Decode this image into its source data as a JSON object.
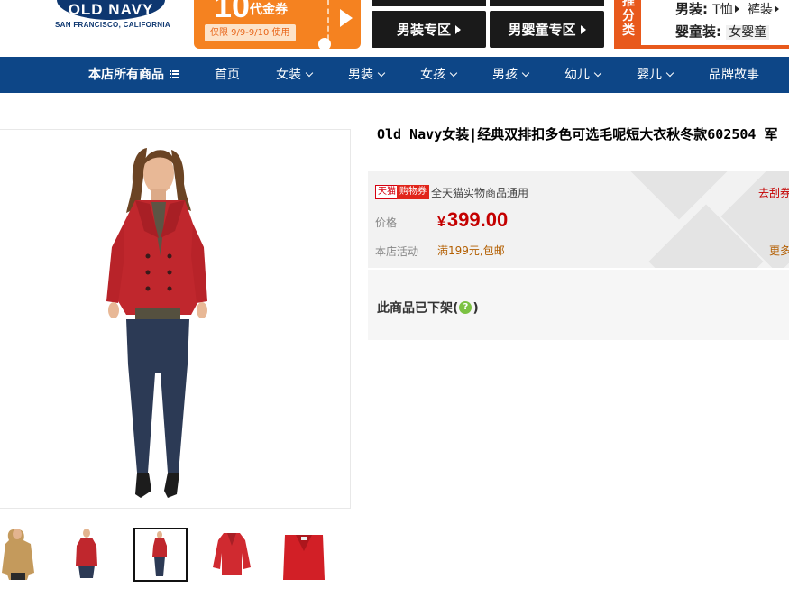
{
  "brand": {
    "logo_text": "OLD NAVY",
    "logo_sub": "SAN FRANCISCO, CALIFORNIA",
    "color": "#0e3770"
  },
  "banner": {
    "coupon_amount": "10",
    "coupon_label": "代金券",
    "coupon_dates": "仅限 9/9-9/10 使用",
    "mens_zone": "男装专区",
    "baby_boys_zone": "男婴童专区",
    "points_label": "推分类",
    "row1_title": "男装:",
    "row1_link1": "T恤",
    "row1_link2": "裤装",
    "row2_title": "婴童装:",
    "row2_link1": "女婴童"
  },
  "nav": {
    "all_products": "本店所有商品",
    "items": [
      "首页",
      "女装",
      "男装",
      "女孩",
      "男孩",
      "幼儿",
      "婴儿",
      "品牌故事"
    ],
    "color": "#0d4687"
  },
  "gallery": {
    "thumbnails": [
      "camel-coat",
      "red-coat-front",
      "red-coat-full",
      "red-coat-flat",
      "red-coat-closeup"
    ],
    "selected_index": 2
  },
  "product": {
    "title": "Old Navy女装|经典双排扣多色可选毛呢短大衣秋冬款602504 军",
    "badge_tmall": "天猫",
    "badge_coupon": "购物券",
    "coupon_note": "全天猫实物商品通用",
    "scratch_link": "去刮券",
    "price_label": "价格",
    "currency": "¥",
    "price": "399.00",
    "promo_label": "本店活动",
    "promo_text": "满199元,包邮",
    "more_link": "更多",
    "status": "此商品已下架",
    "help_icon": "?",
    "price_color": "#c40000"
  }
}
